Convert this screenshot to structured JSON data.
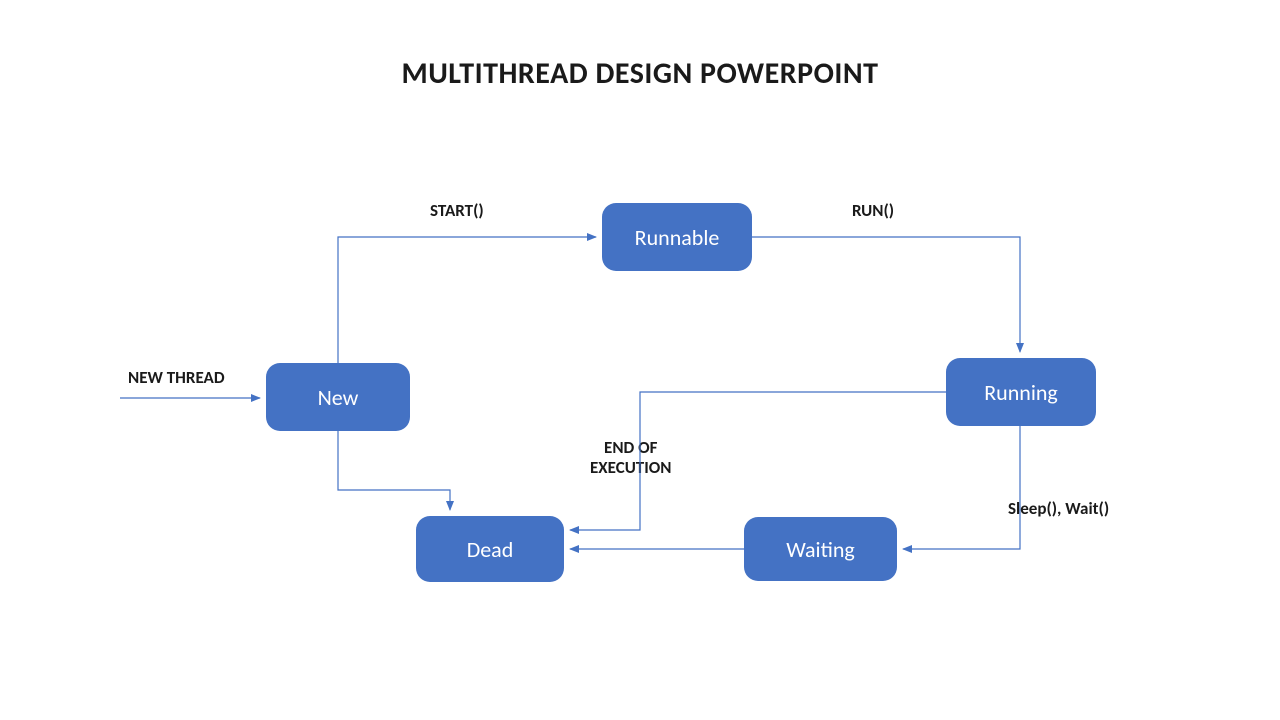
{
  "title": "MULTITHREAD DESIGN POWERPOINT",
  "boxes": {
    "new": "New",
    "runnable": "Runnable",
    "running": "Running",
    "waiting": "Waiting",
    "dead": "Dead"
  },
  "labels": {
    "new_thread": "NEW THREAD",
    "start": "START()",
    "run": "RUN()",
    "sleep_wait": "Sleep(), Wait()",
    "end_of_execution_l1": "END OF",
    "end_of_execution_l2": "EXECUTION"
  },
  "colors": {
    "box_fill": "#4472c4",
    "arrow": "#4472c4"
  }
}
